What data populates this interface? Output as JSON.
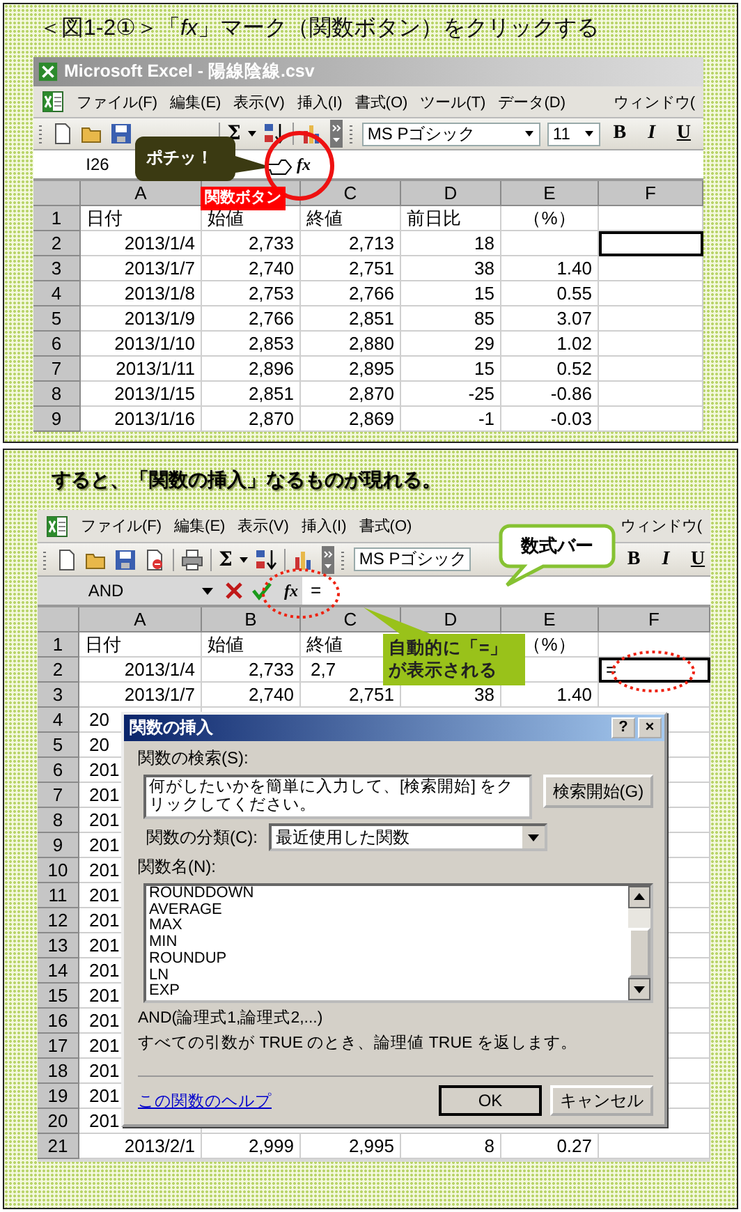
{
  "step1": {
    "caption": "＜図1-2①＞「*fx*」マーク（関数ボタン）をクリックする",
    "window_title": "Microsoft Excel - 陽線陰線.csv",
    "menu": [
      "ファイル(F)",
      "編集(E)",
      "表示(V)",
      "挿入(I)",
      "書式(O)",
      "ツール(T)",
      "データ(D)",
      "ウィンドウ("
    ],
    "autosum_button": "Σ",
    "font_name": "MS Pゴシック",
    "font_size": "11",
    "format_buttons": [
      "B",
      "I",
      "U"
    ],
    "name_box": "I26",
    "function_button": "fx",
    "click_callout": "ポチッ！",
    "button_label": "関数ボタン",
    "columns": [
      {
        "kind": "letter",
        "text": "A"
      },
      {
        "kind": "covered"
      },
      {
        "kind": "letter",
        "text": "C"
      },
      {
        "kind": "letter",
        "text": "D"
      },
      {
        "kind": "letter",
        "text": "E"
      },
      {
        "kind": "letter",
        "text": "F"
      }
    ],
    "rows": [
      {
        "number": "1",
        "cells": [
          {
            "kind": "text",
            "text": "日付"
          },
          {
            "kind": "text",
            "text": "始値"
          },
          {
            "kind": "text",
            "text": "終値"
          },
          {
            "kind": "text",
            "text": "前日比"
          },
          {
            "kind": "center",
            "text": "（%）"
          }
        ]
      },
      {
        "number": "2",
        "cells": [
          {
            "kind": "number",
            "text": "2013/1/4"
          },
          {
            "kind": "number",
            "text": "2,733"
          },
          {
            "kind": "number",
            "text": "2,713"
          },
          {
            "kind": "number",
            "text": "18"
          },
          {
            "kind": "blank"
          },
          {
            "kind": "active"
          }
        ]
      },
      {
        "number": "3",
        "cells": [
          {
            "kind": "number",
            "text": "2013/1/7"
          },
          {
            "kind": "number",
            "text": "2,740"
          },
          {
            "kind": "number",
            "text": "2,751"
          },
          {
            "kind": "number",
            "text": "38"
          },
          {
            "kind": "number",
            "text": "1.40"
          }
        ]
      },
      {
        "number": "4",
        "cells": [
          {
            "kind": "number",
            "text": "2013/1/8"
          },
          {
            "kind": "number",
            "text": "2,753"
          },
          {
            "kind": "number",
            "text": "2,766"
          },
          {
            "kind": "number",
            "text": "15"
          },
          {
            "kind": "number",
            "text": "0.55"
          }
        ]
      },
      {
        "number": "5",
        "cells": [
          {
            "kind": "number",
            "text": "2013/1/9"
          },
          {
            "kind": "number",
            "text": "2,766"
          },
          {
            "kind": "number",
            "text": "2,851"
          },
          {
            "kind": "number",
            "text": "85"
          },
          {
            "kind": "number",
            "text": "3.07"
          }
        ]
      },
      {
        "number": "6",
        "cells": [
          {
            "kind": "number",
            "text": "2013/1/10"
          },
          {
            "kind": "number",
            "text": "2,853"
          },
          {
            "kind": "number",
            "text": "2,880"
          },
          {
            "kind": "number",
            "text": "29"
          },
          {
            "kind": "number",
            "text": "1.02"
          }
        ]
      },
      {
        "number": "7",
        "cells": [
          {
            "kind": "number",
            "text": "2013/1/11"
          },
          {
            "kind": "number",
            "text": "2,896"
          },
          {
            "kind": "number",
            "text": "2,895"
          },
          {
            "kind": "number",
            "text": "15"
          },
          {
            "kind": "number",
            "text": "0.52"
          }
        ]
      },
      {
        "number": "8",
        "cells": [
          {
            "kind": "number",
            "text": "2013/1/15"
          },
          {
            "kind": "number",
            "text": "2,851"
          },
          {
            "kind": "number",
            "text": "2,870"
          },
          {
            "kind": "number",
            "text": "-25"
          },
          {
            "kind": "number",
            "text": "-0.86"
          }
        ]
      },
      {
        "number": "9",
        "cells": [
          {
            "kind": "number",
            "text": "2013/1/16"
          },
          {
            "kind": "number",
            "text": "2,870"
          },
          {
            "kind": "number",
            "text": "2,869"
          },
          {
            "kind": "number",
            "text": "-1"
          },
          {
            "kind": "number",
            "text": "-0.03"
          }
        ]
      }
    ]
  },
  "step2": {
    "caption": "すると、「関数の挿入」なるものが現れる。",
    "menu": [
      "ファイル(F)",
      "編集(E)",
      "表示(V)",
      "挿入(I)",
      "書式(O)",
      "ウィンドウ("
    ],
    "autosum_button": "Σ",
    "font_name": "MS Pゴシック",
    "format_buttons": [
      "B",
      "I",
      "U"
    ],
    "name_box": "AND",
    "function_button": "fx",
    "formula": "=",
    "formula_bar_callout": "数式バー",
    "auto_callout": [
      "自動的に「=」",
      "が表示される"
    ],
    "columns": [
      {
        "kind": "letter",
        "text": "A"
      },
      {
        "kind": "letter",
        "text": "B"
      },
      {
        "kind": "letter",
        "text": "C"
      },
      {
        "kind": "letter",
        "text": "D"
      },
      {
        "kind": "letter",
        "text": "E"
      },
      {
        "kind": "letter",
        "text": "F"
      }
    ],
    "rows": [
      {
        "number": "1",
        "cells": [
          {
            "kind": "text",
            "text": "日付"
          },
          {
            "kind": "text",
            "text": "始値"
          },
          {
            "kind": "text",
            "text": "終値"
          },
          {
            "kind": "covered"
          },
          {
            "kind": "center",
            "text": "（%）"
          }
        ]
      },
      {
        "number": "2",
        "cells": [
          {
            "kind": "number",
            "text": "2013/1/4"
          },
          {
            "kind": "number",
            "text": "2,733"
          },
          {
            "kind": "cut",
            "text": "2,7"
          },
          {
            "kind": "covered"
          },
          {
            "kind": "blank"
          },
          {
            "kind": "active",
            "text": "="
          }
        ]
      },
      {
        "number": "3",
        "cells": [
          {
            "kind": "number",
            "text": "2013/1/7"
          },
          {
            "kind": "number",
            "text": "2,740"
          },
          {
            "kind": "number",
            "text": "2,751"
          },
          {
            "kind": "number",
            "text": "38"
          },
          {
            "kind": "number",
            "text": "1.40"
          }
        ]
      },
      {
        "number": "4",
        "cells": [
          {
            "kind": "cut",
            "text": "20"
          }
        ]
      },
      {
        "number": "5",
        "cells": [
          {
            "kind": "cut",
            "text": "20"
          }
        ]
      },
      {
        "number": "6",
        "cells": [
          {
            "kind": "cut",
            "text": "201"
          }
        ]
      },
      {
        "number": "7",
        "cells": [
          {
            "kind": "cut",
            "text": "201"
          }
        ]
      },
      {
        "number": "8",
        "cells": [
          {
            "kind": "cut",
            "text": "201"
          }
        ]
      },
      {
        "number": "9",
        "cells": [
          {
            "kind": "cut",
            "text": "201"
          }
        ]
      },
      {
        "number": "10",
        "cells": [
          {
            "kind": "cut",
            "text": "201"
          }
        ]
      },
      {
        "number": "11",
        "cells": [
          {
            "kind": "cut",
            "text": "201"
          }
        ]
      },
      {
        "number": "12",
        "cells": [
          {
            "kind": "cut",
            "text": "201"
          }
        ]
      },
      {
        "number": "13",
        "cells": [
          {
            "kind": "cut",
            "text": "201"
          }
        ]
      },
      {
        "number": "14",
        "cells": [
          {
            "kind": "cut",
            "text": "201"
          }
        ]
      },
      {
        "number": "15",
        "cells": [
          {
            "kind": "cut",
            "text": "201"
          }
        ]
      },
      {
        "number": "16",
        "cells": [
          {
            "kind": "cut",
            "text": "201"
          }
        ]
      },
      {
        "number": "17",
        "cells": [
          {
            "kind": "cut",
            "text": "201"
          }
        ]
      },
      {
        "number": "18",
        "cells": [
          {
            "kind": "cut",
            "text": "201"
          }
        ]
      },
      {
        "number": "19",
        "cells": [
          {
            "kind": "cut",
            "text": "201"
          }
        ]
      },
      {
        "number": "20",
        "cells": [
          {
            "kind": "cut",
            "text": "201"
          }
        ]
      },
      {
        "number": "21",
        "cells": [
          {
            "kind": "number",
            "text": "2013/2/1"
          },
          {
            "kind": "number",
            "text": "2,999"
          },
          {
            "kind": "number",
            "text": "2,995"
          },
          {
            "kind": "number",
            "text": "8"
          },
          {
            "kind": "number",
            "text": "0.27"
          }
        ]
      }
    ],
    "dialog": {
      "title": "関数の挿入",
      "help_button": "?",
      "close_button": "×",
      "search_label": "関数の検索(S):",
      "search_text": "何がしたいかを簡単に入力して、[検索開始] をクリックしてください。",
      "search_button": "検索開始(G)",
      "category_label": "関数の分類(C):",
      "category": "最近使用した関数",
      "list_label": "関数名(N):",
      "functions": [
        "ROUNDDOWN",
        "AVERAGE",
        "MAX",
        "MIN",
        "ROUNDUP",
        "LN",
        "EXP"
      ],
      "syntax": "AND(論理式1,論理式2,...)",
      "description": "すべての引数が TRUE のとき、論理値 TRUE を返します。",
      "help_link": "この関数のヘルプ",
      "ok_button": "OK",
      "cancel_button": "キャンセル"
    }
  }
}
